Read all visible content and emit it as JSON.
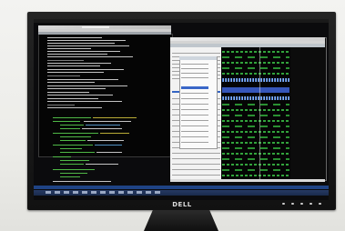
{
  "scene": {
    "description_kind": "photo-of-monitor",
    "brand_logo": "DELL",
    "colors": {
      "bezel": "#1a1a1a",
      "background": "#eeeeea",
      "terminal_text_green": "#53c24a",
      "waveform_green": "#41d84e",
      "waveform_blue": "#3f65d9",
      "taskbar_blue": "#234e9a"
    }
  },
  "monitor": {
    "screen_windows": [
      {
        "kind": "terminal-editor"
      },
      {
        "kind": "waveform-simulator"
      },
      {
        "kind": "signal-list-popup"
      }
    ],
    "front_buttons_count": 6
  }
}
